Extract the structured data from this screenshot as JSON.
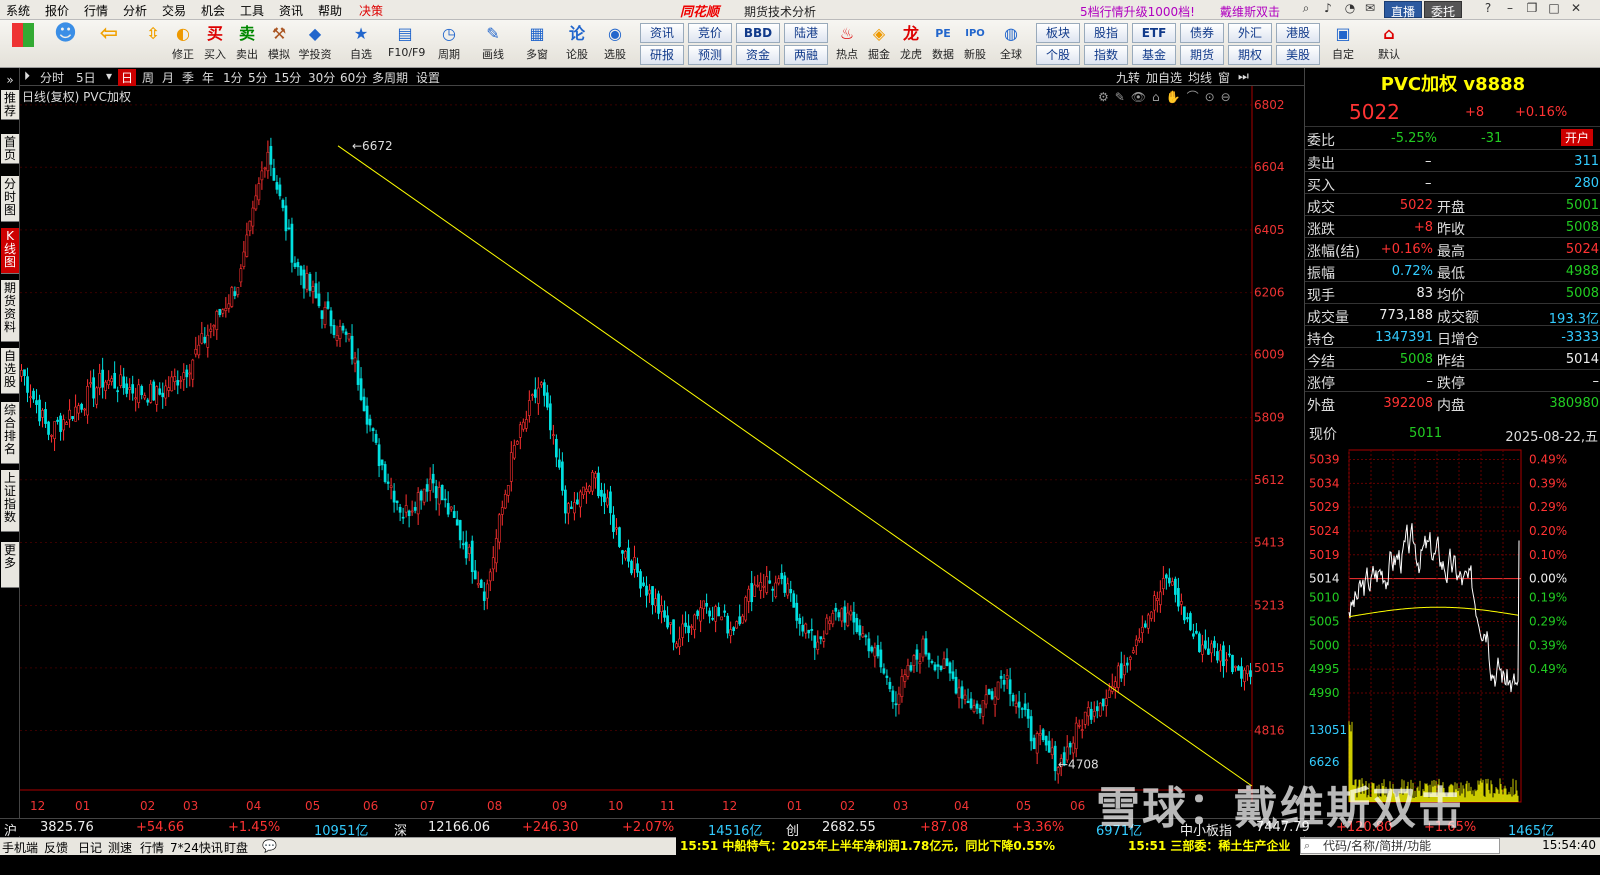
{
  "menubar": {
    "items": [
      "系统",
      "报价",
      "行情",
      "分析",
      "交易",
      "机会",
      "工具",
      "资讯",
      "帮助",
      "决策"
    ],
    "brand": "同花顺",
    "subtitle": "期货技术分析",
    "promo": "5档行情升级1000档!",
    "promo2": "戴维斯双击",
    "live": "直播",
    "trade": "委托"
  },
  "toolbar": {
    "buttons": [
      "",
      "修正",
      "买入",
      "卖出",
      "模拟",
      "学投资",
      "自选",
      "F10/F9",
      "周期",
      "画线",
      "多窗",
      "论股",
      "选股",
      "热点",
      "掘金",
      "龙虎",
      "数据",
      "新股",
      "全球",
      "",
      "自定",
      "默认"
    ],
    "small_top": [
      "资讯",
      "竞价",
      "BBD",
      "陆港",
      "板块",
      "股指",
      "ETF",
      "债券",
      "外汇",
      "港股"
    ],
    "small_bottom": [
      "研报",
      "预测",
      "资金",
      "两融",
      "个股",
      "指数",
      "基金",
      "期货",
      "期权",
      "美股"
    ]
  },
  "left_tabs": [
    "推荐",
    "首页",
    "分时图",
    "K线图",
    "期货资料",
    "自选股",
    "综合排名",
    "上证指数",
    "更多"
  ],
  "period_bar": {
    "items": [
      "分时",
      "5日",
      "日",
      "周",
      "月",
      "季",
      "年",
      "1分",
      "5分",
      "15分",
      "30分",
      "60分",
      "多周期",
      "设置"
    ],
    "right": [
      "九转",
      "加自选",
      "均线",
      "窗"
    ]
  },
  "chart": {
    "title": "日线(复权)  PVC加权",
    "high_label": "6672",
    "low_label": "4708",
    "watermark": "雪球：戴维斯双击"
  },
  "chart_data": {
    "type": "candlestick",
    "title": "日线(复权) PVC加权",
    "y_ticks": [
      6802,
      6604,
      6405,
      6206,
      6009,
      5809,
      5612,
      5413,
      5213,
      5015,
      4816
    ],
    "x_ticks": [
      "12",
      "01",
      "02",
      "03",
      "04",
      "05",
      "06",
      "07",
      "08",
      "09",
      "10",
      "11",
      "12",
      "01",
      "02",
      "03",
      "04",
      "05",
      "06"
    ],
    "ylim": [
      4640,
      6830
    ],
    "trendline": {
      "from": 6672,
      "to": 4640,
      "color": "#ffff00"
    },
    "anchor_closes": [
      5960,
      5760,
      5840,
      5930,
      5900,
      5880,
      5960,
      6100,
      6250,
      6672,
      6300,
      6150,
      6050,
      5700,
      5500,
      5620,
      5450,
      5250,
      5700,
      5920,
      5500,
      5620,
      5400,
      5250,
      5100,
      5230,
      5140,
      5300,
      5260,
      5090,
      5200,
      5100,
      4920,
      5080,
      4990,
      4880,
      5000,
      4800,
      4708,
      4870,
      4960,
      5150,
      5300,
      5100,
      5050,
      5000
    ],
    "intraday": {
      "price": 5011,
      "date": "2025-08-22,五",
      "left_ticks": [
        5039,
        5034,
        5029,
        5024,
        5019,
        5014,
        5010,
        5005,
        5000,
        4995,
        4990
      ],
      "right_ticks": [
        "0.49%",
        "0.39%",
        "0.29%",
        "0.20%",
        "0.10%",
        "0.00%",
        "0.19%",
        "0.29%",
        "0.39%",
        "0.49%"
      ],
      "vol_ticks": [
        13051,
        6626
      ]
    }
  },
  "quote": {
    "title": "PVC加权 v8888",
    "price": "5022",
    "chg": "+8",
    "pct": "+0.16%",
    "weibi_label": "委比",
    "weibi": "-5.25%",
    "weicha": "-31",
    "open_badge": "开户",
    "sell_label": "卖出",
    "sell": "–",
    "sell_vol": "311",
    "buy_label": "买入",
    "buy": "–",
    "buy_vol": "280",
    "rows": [
      {
        "l1": "成交",
        "v1": "5022",
        "c1": "red",
        "l2": "开盘",
        "v2": "5001",
        "c2": "green"
      },
      {
        "l1": "涨跌",
        "v1": "+8",
        "c1": "red",
        "l2": "昨收",
        "v2": "5008",
        "c2": "green"
      },
      {
        "l1": "涨幅(结)",
        "v1": "+0.16%",
        "c1": "red",
        "l2": "最高",
        "v2": "5024",
        "c2": "red"
      },
      {
        "l1": "振幅",
        "v1": "0.72%",
        "c1": "cyan",
        "l2": "最低",
        "v2": "4988",
        "c2": "green"
      },
      {
        "l1": "现手",
        "v1": "83",
        "c1": "white",
        "l2": "均价",
        "v2": "5008",
        "c2": "green"
      },
      {
        "l1": "成交量",
        "v1": "773,188",
        "c1": "white",
        "l2": "成交额",
        "v2": "193.3亿",
        "c2": "cyan"
      },
      {
        "l1": "持仓",
        "v1": "1347391",
        "c1": "cyan",
        "l2": "日增仓",
        "v2": "-3333",
        "c2": "cyan"
      },
      {
        "l1": "今结",
        "v1": "5008",
        "c1": "green",
        "l2": "昨结",
        "v2": "5014",
        "c2": "white"
      },
      {
        "l1": "涨停",
        "v1": "–",
        "c1": "white",
        "l2": "跌停",
        "v2": "–",
        "c2": "white"
      },
      {
        "l1": "外盘",
        "v1": "392208",
        "c1": "red",
        "l2": "内盘",
        "v2": "380980",
        "c2": "green"
      }
    ],
    "now_label": "现价",
    "now": "5011",
    "date": "2025-08-22,五"
  },
  "status": {
    "sh_label": "沪",
    "sh": "3825.76",
    "sh_chg": "+54.66",
    "sh_pct": "+1.45%",
    "sh_amt": "10951亿",
    "sz_label": "深",
    "sz": "12166.06",
    "sz_chg": "+246.30",
    "sz_pct": "+2.07%",
    "sz_amt": "14516亿",
    "cy_label": "创",
    "cy": "2682.55",
    "cy_chg": "+87.08",
    "cy_pct": "+3.36%",
    "cy_amt": "6971亿",
    "zx_label": "中小板指",
    "zx": "7447.79",
    "zx_chg": "+120.80",
    "zx_pct": "+1.65%",
    "zx_amt": "1465亿"
  },
  "bottom": {
    "items": [
      "手机端",
      "反馈",
      "日记",
      "测速",
      "行情",
      "7*24快讯",
      "盯盘"
    ],
    "news1": "15:51 中船特气：2025年上半年净利润1.78亿元，同比下降0.55%",
    "news2": "15:51 三部委：稀土生产企业",
    "search": "代码/名称/简拼/功能",
    "clock": "15:54:40"
  }
}
